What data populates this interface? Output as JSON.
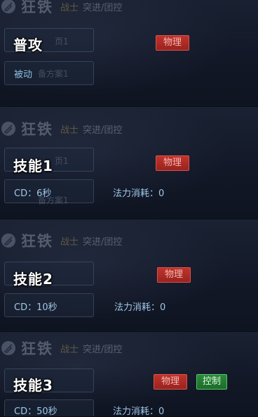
{
  "hero": {
    "name": "狂铁",
    "role": "战士",
    "tags": "突进/团控"
  },
  "ghost": {
    "page_label": "页1",
    "plan_label": "备方案1"
  },
  "sections": [
    {
      "title": "普攻",
      "tag_physical": "物理",
      "passive": "被动"
    },
    {
      "title": "技能1",
      "tag_physical": "物理",
      "cd_label": "CD：6秒",
      "mana_label": "法力消耗：0"
    },
    {
      "title": "技能2",
      "tag_physical": "物理",
      "cd_label": "CD：10秒",
      "mana_label": "法力消耗：0"
    },
    {
      "title": "技能3",
      "tag_physical": "物理",
      "tag_control": "控制",
      "cd_label": "CD：50秒",
      "mana_label": "法力消耗：0"
    }
  ],
  "colors": {
    "physical_tag": "#b82a26",
    "control_tag": "#26803a",
    "info_text": "#9fc7e8"
  }
}
